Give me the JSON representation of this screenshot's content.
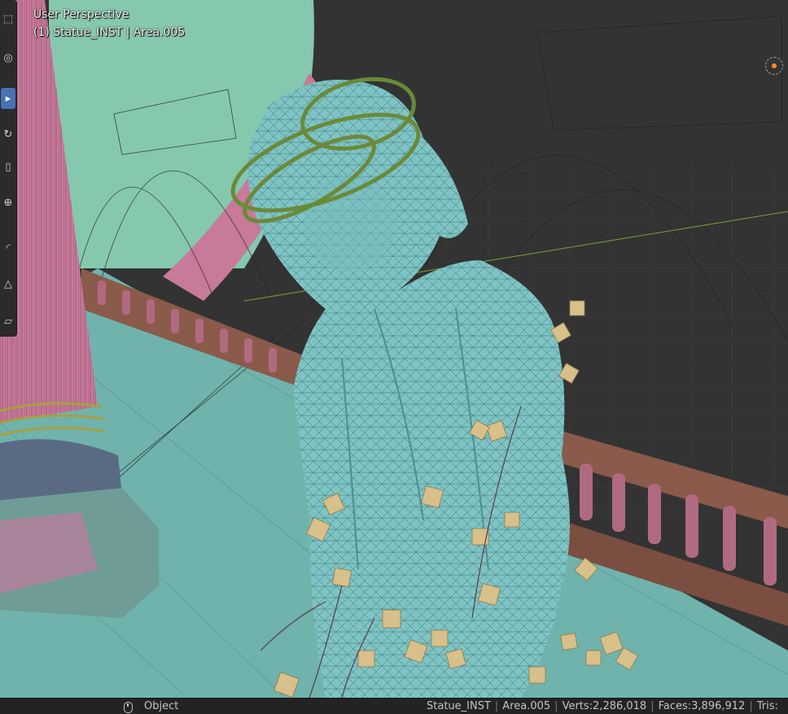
{
  "viewport": {
    "view_name": "User Perspective",
    "active_object_label": "(1) Statue_INST | Area.005"
  },
  "toolbar": {
    "tools": [
      {
        "name": "select-box-tool",
        "glyph": "⬚",
        "active": false
      },
      {
        "name": "cursor-tool",
        "glyph": "◎",
        "active": false
      },
      {
        "name": "move-tool",
        "glyph": "▸",
        "active": true
      },
      {
        "name": "rotate-tool",
        "glyph": "↻",
        "active": false
      },
      {
        "name": "scale-tool",
        "glyph": "▯",
        "active": false
      },
      {
        "name": "transform-tool",
        "glyph": "⊕",
        "active": false
      },
      {
        "name": "annotate-tool",
        "glyph": "◜",
        "active": false
      },
      {
        "name": "measure-tool",
        "glyph": "△",
        "active": false
      },
      {
        "name": "add-cube-tool",
        "glyph": "▱",
        "active": false
      }
    ]
  },
  "statusbar": {
    "mode_label": "Object",
    "object": "Statue_INST",
    "collection": "Area.005",
    "verts": "Verts:2,286,018",
    "faces": "Faces:3,896,912",
    "tris": "Tris:"
  },
  "colors": {
    "floor": "#6fb3ac",
    "statue": "#7fc4c4",
    "column": "#c77a9a",
    "railing": "#8a5a4a",
    "leaf": "#d8c08a",
    "active_tool": "#4772b3"
  }
}
